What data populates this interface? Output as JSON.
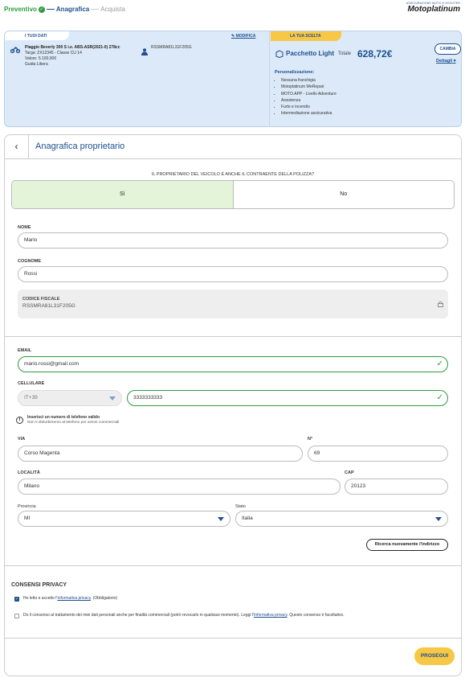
{
  "steps": [
    {
      "label": "Preventivo",
      "state": "done"
    },
    {
      "label": "Anagrafica",
      "state": "active"
    },
    {
      "label": "Acquista",
      "state": "next"
    }
  ],
  "logo": {
    "small": "ASSICURAZIONE MOTO E SCOOTER",
    "main": "Motoplatinum"
  },
  "summary": {
    "tag": "I TUOI DATI",
    "edit_label": "MODIFICA",
    "vehicle": {
      "title": "Piaggio Beverly 300 S i.e. ABS-ASR(2021-0) 278cc",
      "plate_class": "Targa: ZX12345 - Classe CU 14",
      "value": "Valore: 5.100,00€",
      "guide": "Guida Libera"
    },
    "owner_cf": "RSSMRA81L31F205G",
    "choice": {
      "tag": "LA TUA SCELTA",
      "package": "Pacchetto Light",
      "total_label": "Totale",
      "total_value": "628,72€",
      "change_label": "CAMBIA",
      "details_label": "Dettagli",
      "custom_title": "Personalizzazione:",
      "custom_items": [
        "Nessuna franchigia",
        "Motoplatinum WeRepair",
        "MOTO.APP - Livello Adventure",
        "Assistenza",
        "Furto e incendio",
        "Intermediazione assicurativa"
      ]
    }
  },
  "form": {
    "title": "Anagrafica proprietario",
    "question": "IL PROPRIETARIO DEL VEICOLO È ANCHE IL CONTRAENTE DELLA POLIZZA?",
    "yes": "Sì",
    "no": "No",
    "nome_label": "NOME",
    "nome_value": "Mario",
    "cognome_label": "COGNOME",
    "cognome_value": "Rossi",
    "cf_label": "CODICE FISCALE",
    "cf_value": "RSSMRA81L31F205G",
    "email_label": "EMAIL",
    "email_value": "mario.rossi@gmail.com",
    "cell_label": "CELLULARE",
    "prefix_value": "IT+39",
    "cell_value": "3333333333",
    "info_title": "Inserisci un numero di telefono valido",
    "info_sub": "Non ti disturberemo al telefono per azioni commerciali",
    "via_label": "VIA",
    "via_value": "Corso Magenta",
    "num_label": "N°",
    "num_value": "69",
    "loc_label": "LOCALITÀ",
    "loc_value": "Milano",
    "cap_label": "CAP",
    "cap_value": "20123",
    "prov_label": "Provincia",
    "prov_value": "MI",
    "stato_label": "Stato",
    "stato_value": "Italia",
    "search_again": "Ricerca nuovamente l'indirizzo"
  },
  "privacy": {
    "title": "CONSENSI PRIVACY",
    "c1_pre": "Ho letto e accetto l'",
    "c1_link": "Informativa privacy",
    "c1_post": ". (Obbligatorio)",
    "c2_pre": "Do il consenso al trattamento dei miei dati personali anche per finalità commerciali (potrò revocarlo in qualsiasi momento). Leggi l'",
    "c2_link": "Informativa privacy",
    "c2_post": ". Questo consenso è facoltativo."
  },
  "submit_label": "PROSEGUI",
  "colors": {
    "brand": "#1e4f8f",
    "accent": "#f7c845",
    "success": "#2e9b3e"
  }
}
